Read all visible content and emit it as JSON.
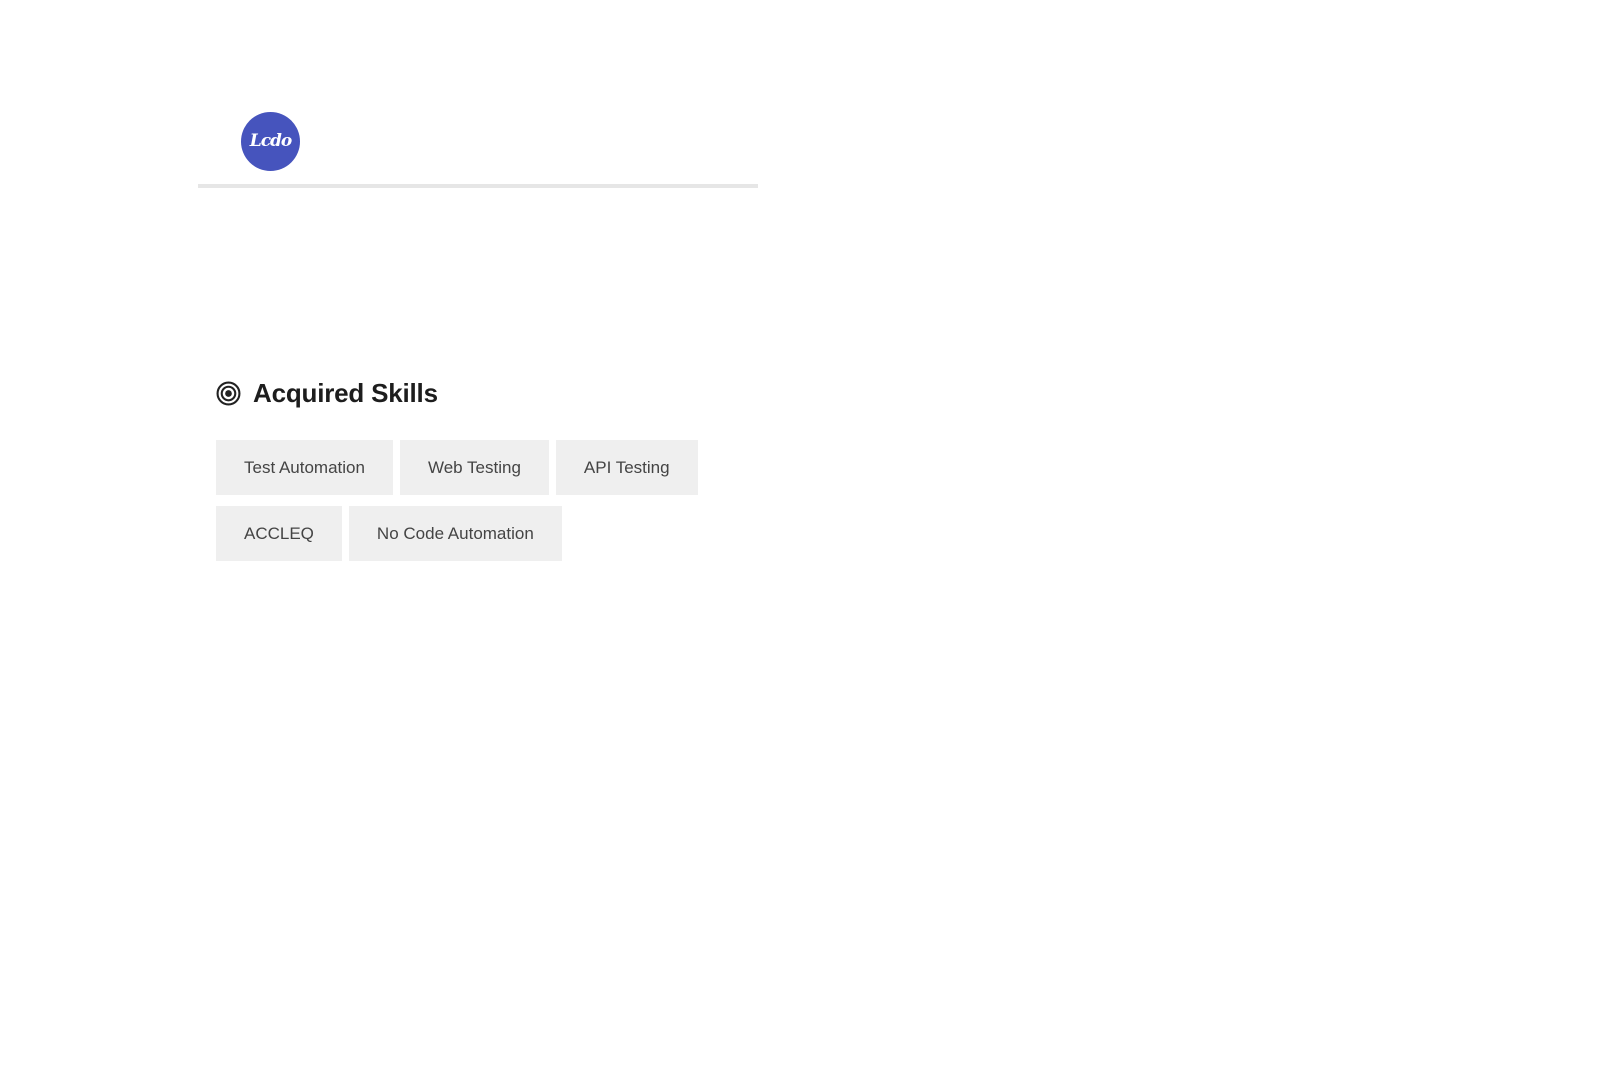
{
  "theme": {
    "accent": "#4654bd",
    "tag_background": "#efefef"
  },
  "header": {
    "avatar_text": "Lcdo",
    "avatar_icon": "logo-avatar-icon"
  },
  "skills": {
    "icon": "target-icon",
    "heading": "Acquired Skills",
    "rows": [
      [
        "Test Automation",
        "Web Testing",
        "API Testing"
      ],
      [
        "ACCLEQ",
        "No Code Automation"
      ]
    ]
  }
}
